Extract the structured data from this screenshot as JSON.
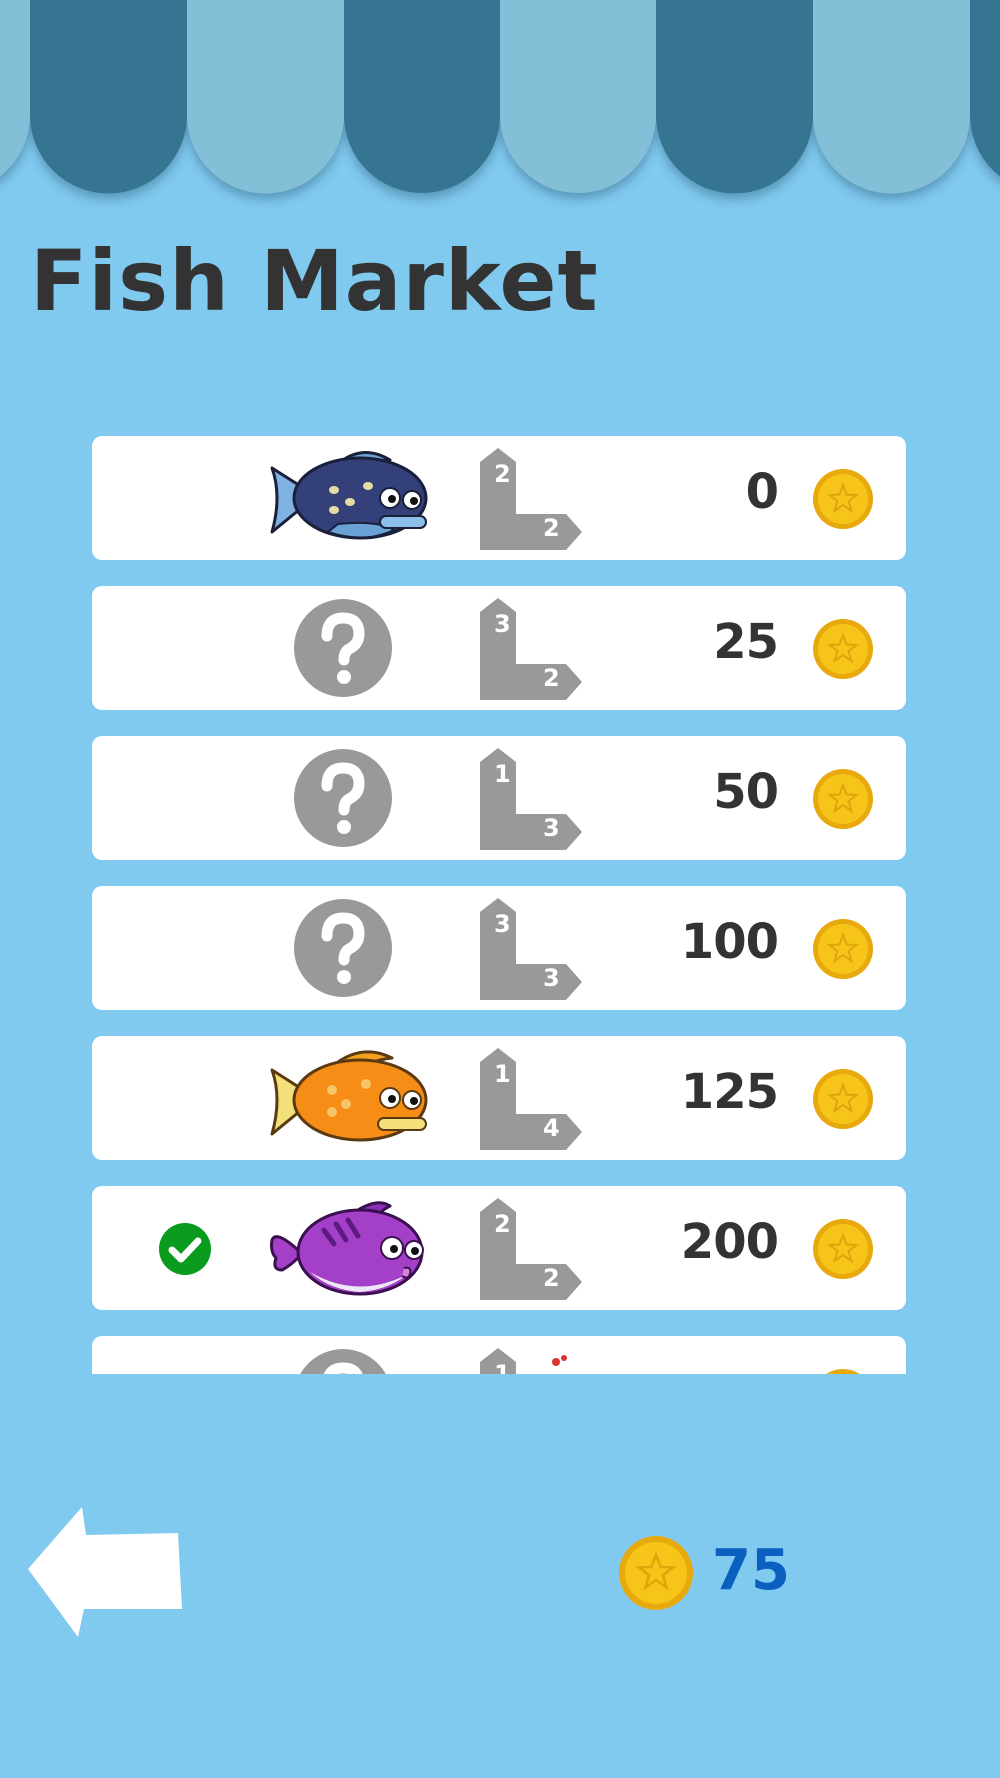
{
  "title": "Fish Market",
  "colors": {
    "background": "#80c9ef",
    "awning_dark": "#347592",
    "awning_light": "#83bfd6",
    "coin": "#f5c518",
    "locked_gray": "#999999",
    "owned_check": "#0a9a1e",
    "wallet_text": "#0a5fbf"
  },
  "items": [
    {
      "fish": "navy-fish",
      "size_top": "2",
      "size_bottom": "2",
      "price": "0",
      "owned": false,
      "locked": false
    },
    {
      "fish": "question-mark",
      "size_top": "3",
      "size_bottom": "2",
      "price": "25",
      "owned": false,
      "locked": true
    },
    {
      "fish": "question-mark",
      "size_top": "1",
      "size_bottom": "3",
      "price": "50",
      "owned": false,
      "locked": true
    },
    {
      "fish": "question-mark",
      "size_top": "3",
      "size_bottom": "3",
      "price": "100",
      "owned": false,
      "locked": true
    },
    {
      "fish": "orange-fish",
      "size_top": "1",
      "size_bottom": "4",
      "price": "125",
      "owned": false,
      "locked": false
    },
    {
      "fish": "purple-puffer-fish",
      "size_top": "2",
      "size_bottom": "2",
      "price": "200",
      "owned": true,
      "locked": false
    },
    {
      "fish": "question-mark",
      "size_top": "1",
      "size_bottom": "",
      "price": "",
      "owned": false,
      "locked": true
    }
  ],
  "wallet": {
    "coins": "75"
  },
  "icons": {
    "back": "back-arrow-icon",
    "coin": "coin-icon",
    "check": "check-icon",
    "locked": "question-mark-icon"
  }
}
